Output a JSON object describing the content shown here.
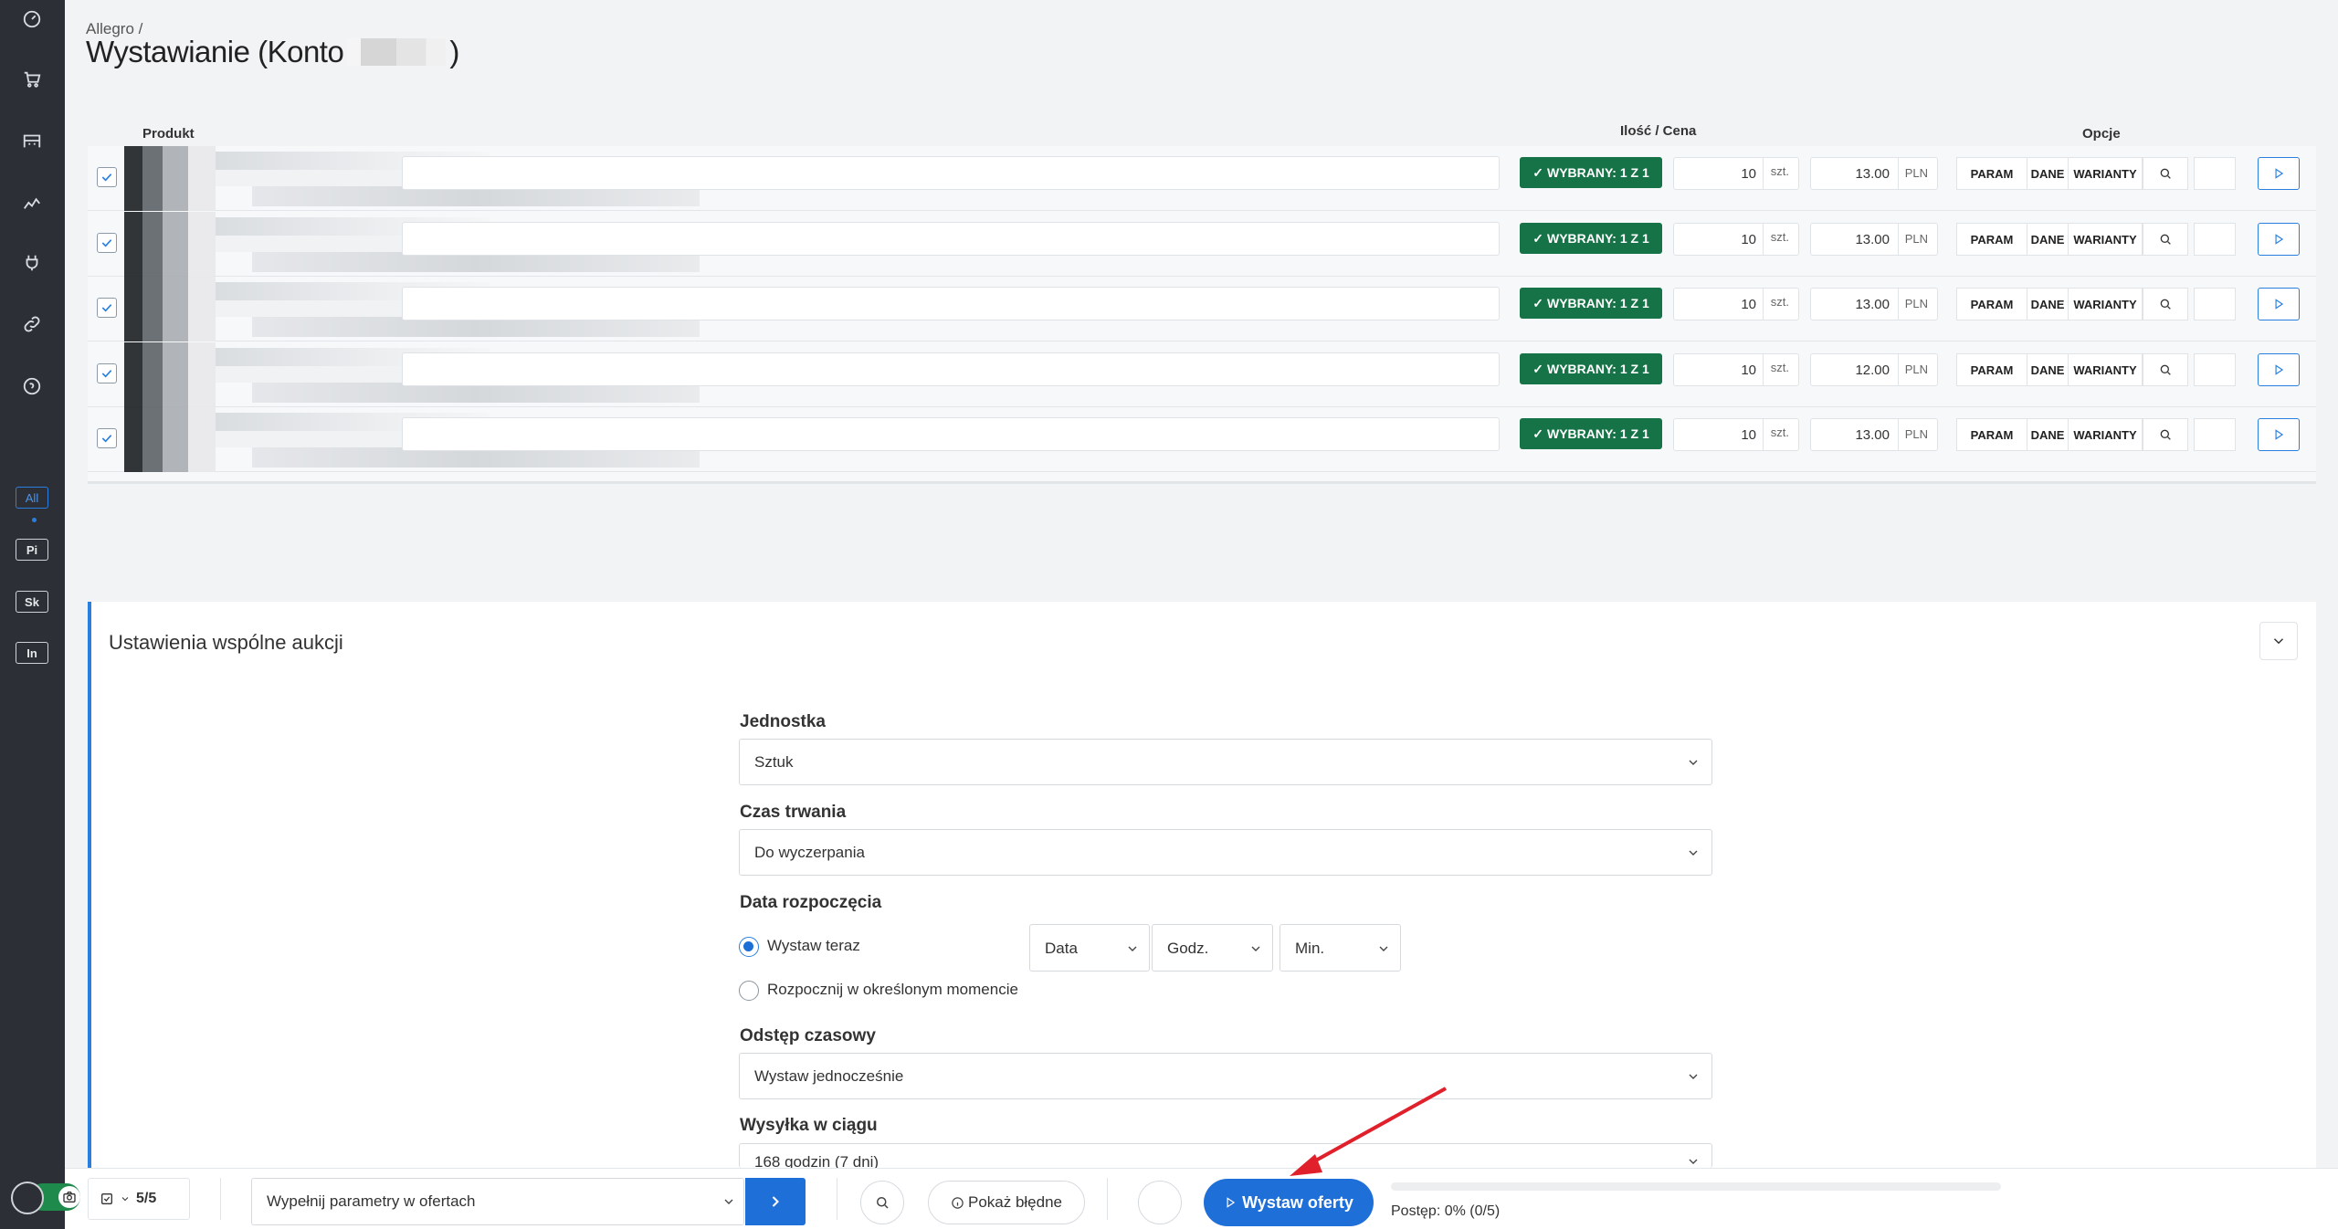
{
  "header": {
    "breadcrumb": "Allegro /",
    "title_prefix": "Wystawianie (Konto",
    "title_suffix": ")"
  },
  "sidebar": {
    "icons": [
      "dashboard-icon",
      "cart-icon",
      "warehouse-icon",
      "stats-icon",
      "plug-icon",
      "link-icon",
      "help-icon"
    ],
    "badges": [
      "All",
      "Pi",
      "Sk",
      "In"
    ]
  },
  "table": {
    "col_product": "Produkt",
    "col_qty_price": "Ilość / Cena",
    "col_options": "Opcje",
    "rows": [
      {
        "selected_label": "WYBRANY: 1 Z 1",
        "qty": "10",
        "qty_unit": "szt.",
        "price": "13.00",
        "currency": "PLN"
      },
      {
        "selected_label": "WYBRANY: 1 Z 1",
        "qty": "10",
        "qty_unit": "szt.",
        "price": "13.00",
        "currency": "PLN"
      },
      {
        "selected_label": "WYBRANY: 1 Z 1",
        "qty": "10",
        "qty_unit": "szt.",
        "price": "13.00",
        "currency": "PLN"
      },
      {
        "selected_label": "WYBRANY: 1 Z 1",
        "qty": "10",
        "qty_unit": "szt.",
        "price": "12.00",
        "currency": "PLN"
      },
      {
        "selected_label": "WYBRANY: 1 Z 1",
        "qty": "10",
        "qty_unit": "szt.",
        "price": "13.00",
        "currency": "PLN"
      }
    ],
    "opt_param": "PARAM",
    "opt_dane": "DANE",
    "opt_warianty": "WARIANTY"
  },
  "settings": {
    "title": "Ustawienia wspólne aukcji",
    "unit_label": "Jednostka",
    "unit_value": "Sztuk",
    "duration_label": "Czas trwania",
    "duration_value": "Do wyczerpania",
    "start_label": "Data rozpoczęcia",
    "start_now": "Wystaw teraz",
    "start_scheduled": "Rozpocznij w określonym momencie",
    "date_placeholder": "Data",
    "hour_placeholder": "Godz.",
    "min_placeholder": "Min.",
    "interval_label": "Odstęp czasowy",
    "interval_value": "Wystaw jednocześnie",
    "shipping_label": "Wysyłka w ciągu",
    "shipping_value": "168 godzin (7 dni)"
  },
  "bottombar": {
    "selected_count": "5/5",
    "action_value": "Wypełnij parametry w ofertach",
    "show_errors": "Pokaż błędne",
    "publish": "Wystaw oferty",
    "progress_label": "Postęp:",
    "progress_value": "0% (0/5)",
    "progress_fraction": 0
  },
  "colors": {
    "accent": "#1f6fd8",
    "success": "#157347",
    "sidebar": "#2c3036",
    "annotation_arrow": "#e0202a"
  }
}
